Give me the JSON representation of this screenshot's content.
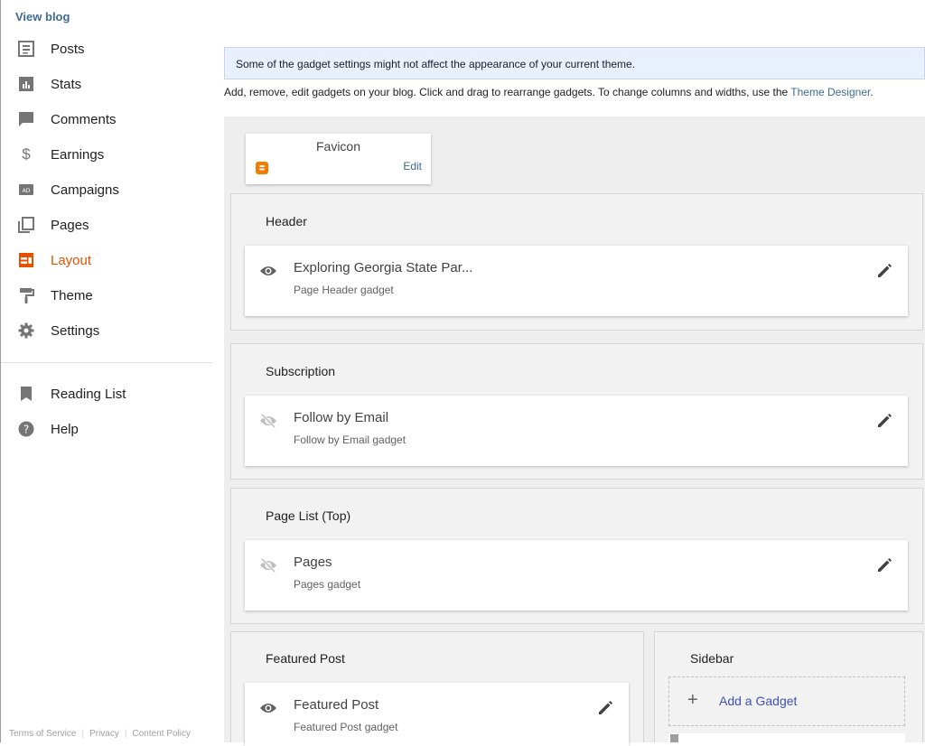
{
  "sidebar": {
    "view_blog": "View blog",
    "items": [
      {
        "label": "Posts",
        "icon": "posts-icon"
      },
      {
        "label": "Stats",
        "icon": "stats-icon"
      },
      {
        "label": "Comments",
        "icon": "comments-icon"
      },
      {
        "label": "Earnings",
        "icon": "earnings-icon"
      },
      {
        "label": "Campaigns",
        "icon": "campaigns-icon"
      },
      {
        "label": "Pages",
        "icon": "pages-icon"
      },
      {
        "label": "Layout",
        "icon": "layout-icon",
        "active": true
      },
      {
        "label": "Theme",
        "icon": "theme-icon"
      },
      {
        "label": "Settings",
        "icon": "settings-icon"
      }
    ],
    "secondary": [
      {
        "label": "Reading List",
        "icon": "bookmark-icon"
      },
      {
        "label": "Help",
        "icon": "help-icon"
      }
    ],
    "footer": {
      "terms": "Terms of Service",
      "privacy": "Privacy",
      "content_policy": "Content Policy"
    }
  },
  "colors": {
    "accent": "#e65100",
    "link": "#3f6b8e",
    "blogger_orange": "#f57c00"
  },
  "main": {
    "notice": "Some of the gadget settings might not affect the appearance of your current theme.",
    "instructions": "Add, remove, edit gadgets on your blog. Click and drag to rearrange gadgets. To change columns and widths, use the ",
    "theme_designer_link": "Theme Designer",
    "favicon": {
      "title": "Favicon",
      "edit": "Edit"
    },
    "sections": {
      "header": {
        "title": "Header",
        "gadget_title": "Exploring Georgia State Par...",
        "gadget_sub": "Page Header gadget"
      },
      "subscription": {
        "title": "Subscription",
        "gadget_title": "Follow by Email",
        "gadget_sub": "Follow by Email gadget"
      },
      "page_list": {
        "title": "Page List (Top)",
        "gadget_title": "Pages",
        "gadget_sub": "Pages gadget"
      },
      "featured": {
        "title": "Featured Post",
        "gadget_title": "Featured Post",
        "gadget_sub": "Featured Post gadget"
      },
      "sidebar": {
        "title": "Sidebar",
        "add_gadget": "Add a Gadget"
      }
    }
  }
}
